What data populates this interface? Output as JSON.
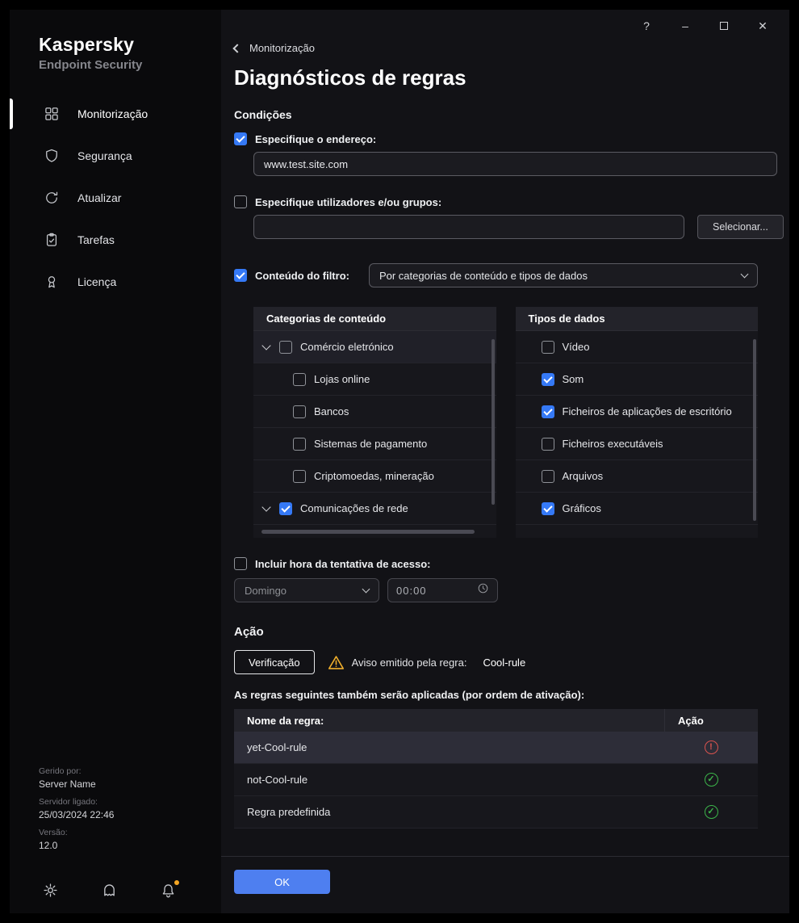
{
  "titlebar": {
    "help": "?",
    "minimize": "–",
    "close": "✕"
  },
  "brand": {
    "name": "Kaspersky",
    "product": "Endpoint Security"
  },
  "sidebar": {
    "items": [
      {
        "label": "Monitorização",
        "icon": "grid-icon",
        "active": true
      },
      {
        "label": "Segurança",
        "icon": "shield-icon",
        "active": false
      },
      {
        "label": "Atualizar",
        "icon": "refresh-icon",
        "active": false
      },
      {
        "label": "Tarefas",
        "icon": "tasks-icon",
        "active": false
      },
      {
        "label": "Licença",
        "icon": "license-icon",
        "active": false
      }
    ],
    "footer": {
      "managed_by_label": "Gerido por:",
      "managed_by_value": "Server Name",
      "server_label": "Servidor ligado:",
      "server_value": "25/03/2024 22:46",
      "version_label": "Versão:",
      "version_value": "12.0"
    }
  },
  "header": {
    "back_label": "Monitorização",
    "title": "Diagnósticos de regras"
  },
  "conditions": {
    "section_label": "Condições",
    "address": {
      "checked": true,
      "label": "Especifique o endereço:",
      "value": "www.test.site.com"
    },
    "users": {
      "checked": false,
      "label": "Especifique utilizadores e/ou grupos:",
      "value": "",
      "select_button": "Selecionar..."
    },
    "filter": {
      "checked": true,
      "label": "Conteúdo do filtro:",
      "selected_option": "Por categorias de conteúdo e tipos de dados"
    },
    "categories": {
      "title": "Categorias de conteúdo",
      "items": [
        {
          "label": "Comércio eletrónico",
          "checked": false,
          "expanded": true,
          "level": 0
        },
        {
          "label": "Lojas online",
          "checked": false,
          "level": 1
        },
        {
          "label": "Bancos",
          "checked": false,
          "level": 1
        },
        {
          "label": "Sistemas de pagamento",
          "checked": false,
          "level": 1
        },
        {
          "label": "Criptomoedas, mineração",
          "checked": false,
          "level": 1
        },
        {
          "label": "Comunicações de rede",
          "checked": true,
          "expanded": true,
          "level": 0
        }
      ]
    },
    "data_types": {
      "title": "Tipos de dados",
      "items": [
        {
          "label": "Vídeo",
          "checked": false
        },
        {
          "label": "Som",
          "checked": true
        },
        {
          "label": "Ficheiros de aplicações de escritório",
          "checked": true
        },
        {
          "label": "Ficheiros executáveis",
          "checked": false
        },
        {
          "label": "Arquivos",
          "checked": false
        },
        {
          "label": "Gráficos",
          "checked": true
        }
      ]
    },
    "time": {
      "checked": false,
      "label": "Incluir hora da tentativa de acesso:",
      "day_selected": "Domingo",
      "time_value": "00:00"
    }
  },
  "action": {
    "section_label": "Ação",
    "verify_button": "Verificação",
    "warning_text": "Aviso emitido pela regra:",
    "rule_name": "Cool-rule",
    "applied_rules_label": "As regras seguintes também serão aplicadas (por ordem de ativação):",
    "table": {
      "col_name": "Nome da regra:",
      "col_action": "Ação",
      "rows": [
        {
          "name": "yet-Cool-rule",
          "status": "error"
        },
        {
          "name": "not-Cool-rule",
          "status": "ok"
        },
        {
          "name": "Regra predefinida",
          "status": "ok"
        }
      ]
    }
  },
  "bottom_bar": {
    "ok": "OK"
  }
}
